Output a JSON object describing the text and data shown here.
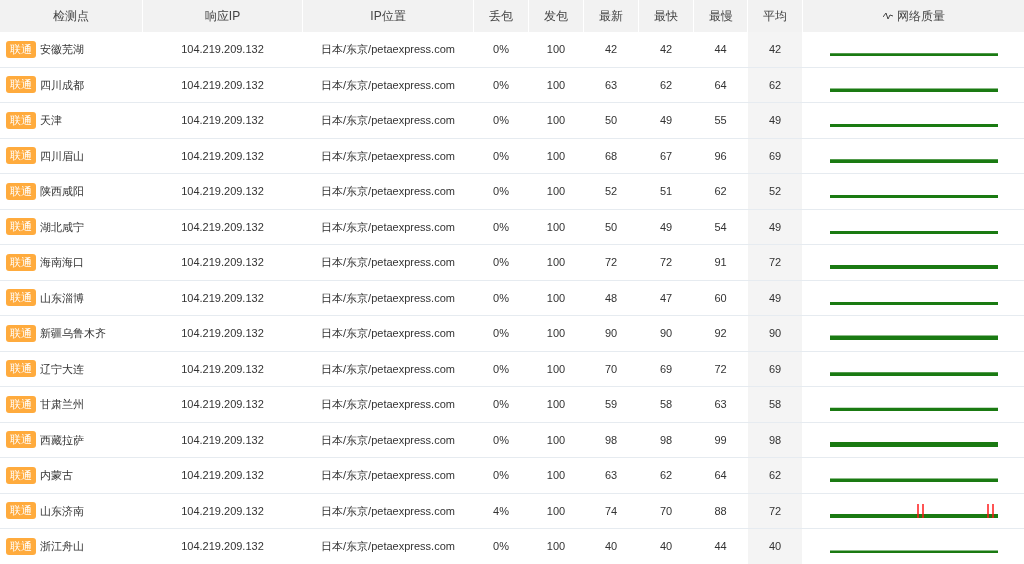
{
  "columns": [
    "检测点",
    "响应IP",
    "IP位置",
    "丢包",
    "发包",
    "最新",
    "最快",
    "最慢",
    "平均",
    "网络质量"
  ],
  "rows": [
    {
      "isp": "联通",
      "location": "安徽芜湖",
      "ip": "104.219.209.132",
      "geo": "日本/东京/petaexpress.com",
      "loss": "0%",
      "sent": "100",
      "last": "42",
      "best": "42",
      "worst": "44",
      "avg": "42"
    },
    {
      "isp": "联通",
      "location": "四川成都",
      "ip": "104.219.209.132",
      "geo": "日本/东京/petaexpress.com",
      "loss": "0%",
      "sent": "100",
      "last": "63",
      "best": "62",
      "worst": "64",
      "avg": "62"
    },
    {
      "isp": "联通",
      "location": "天津",
      "ip": "104.219.209.132",
      "geo": "日本/东京/petaexpress.com",
      "loss": "0%",
      "sent": "100",
      "last": "50",
      "best": "49",
      "worst": "55",
      "avg": "49"
    },
    {
      "isp": "联通",
      "location": "四川眉山",
      "ip": "104.219.209.132",
      "geo": "日本/东京/petaexpress.com",
      "loss": "0%",
      "sent": "100",
      "last": "68",
      "best": "67",
      "worst": "96",
      "avg": "69"
    },
    {
      "isp": "联通",
      "location": "陕西咸阳",
      "ip": "104.219.209.132",
      "geo": "日本/东京/petaexpress.com",
      "loss": "0%",
      "sent": "100",
      "last": "52",
      "best": "51",
      "worst": "62",
      "avg": "52"
    },
    {
      "isp": "联通",
      "location": "湖北咸宁",
      "ip": "104.219.209.132",
      "geo": "日本/东京/petaexpress.com",
      "loss": "0%",
      "sent": "100",
      "last": "50",
      "best": "49",
      "worst": "54",
      "avg": "49"
    },
    {
      "isp": "联通",
      "location": "海南海口",
      "ip": "104.219.209.132",
      "geo": "日本/东京/petaexpress.com",
      "loss": "0%",
      "sent": "100",
      "last": "72",
      "best": "72",
      "worst": "91",
      "avg": "72"
    },
    {
      "isp": "联通",
      "location": "山东淄博",
      "ip": "104.219.209.132",
      "geo": "日本/东京/petaexpress.com",
      "loss": "0%",
      "sent": "100",
      "last": "48",
      "best": "47",
      "worst": "60",
      "avg": "49"
    },
    {
      "isp": "联通",
      "location": "新疆乌鲁木齐",
      "ip": "104.219.209.132",
      "geo": "日本/东京/petaexpress.com",
      "loss": "0%",
      "sent": "100",
      "last": "90",
      "best": "90",
      "worst": "92",
      "avg": "90"
    },
    {
      "isp": "联通",
      "location": "辽宁大连",
      "ip": "104.219.209.132",
      "geo": "日本/东京/petaexpress.com",
      "loss": "0%",
      "sent": "100",
      "last": "70",
      "best": "69",
      "worst": "72",
      "avg": "69"
    },
    {
      "isp": "联通",
      "location": "甘肃兰州",
      "ip": "104.219.209.132",
      "geo": "日本/东京/petaexpress.com",
      "loss": "0%",
      "sent": "100",
      "last": "59",
      "best": "58",
      "worst": "63",
      "avg": "58"
    },
    {
      "isp": "联通",
      "location": "西藏拉萨",
      "ip": "104.219.209.132",
      "geo": "日本/东京/petaexpress.com",
      "loss": "0%",
      "sent": "100",
      "last": "98",
      "best": "98",
      "worst": "99",
      "avg": "98"
    },
    {
      "isp": "联通",
      "location": "内蒙古",
      "ip": "104.219.209.132",
      "geo": "日本/东京/petaexpress.com",
      "loss": "0%",
      "sent": "100",
      "last": "63",
      "best": "62",
      "worst": "64",
      "avg": "62"
    },
    {
      "isp": "联通",
      "location": "山东济南",
      "ip": "104.219.209.132",
      "geo": "日本/东京/petaexpress.com",
      "loss": "4%",
      "sent": "100",
      "last": "74",
      "best": "70",
      "worst": "88",
      "avg": "72"
    },
    {
      "isp": "联通",
      "location": "浙江舟山",
      "ip": "104.219.209.132",
      "geo": "日本/东京/petaexpress.com",
      "loss": "0%",
      "sent": "100",
      "last": "40",
      "best": "40",
      "worst": "44",
      "avg": "40"
    }
  ]
}
